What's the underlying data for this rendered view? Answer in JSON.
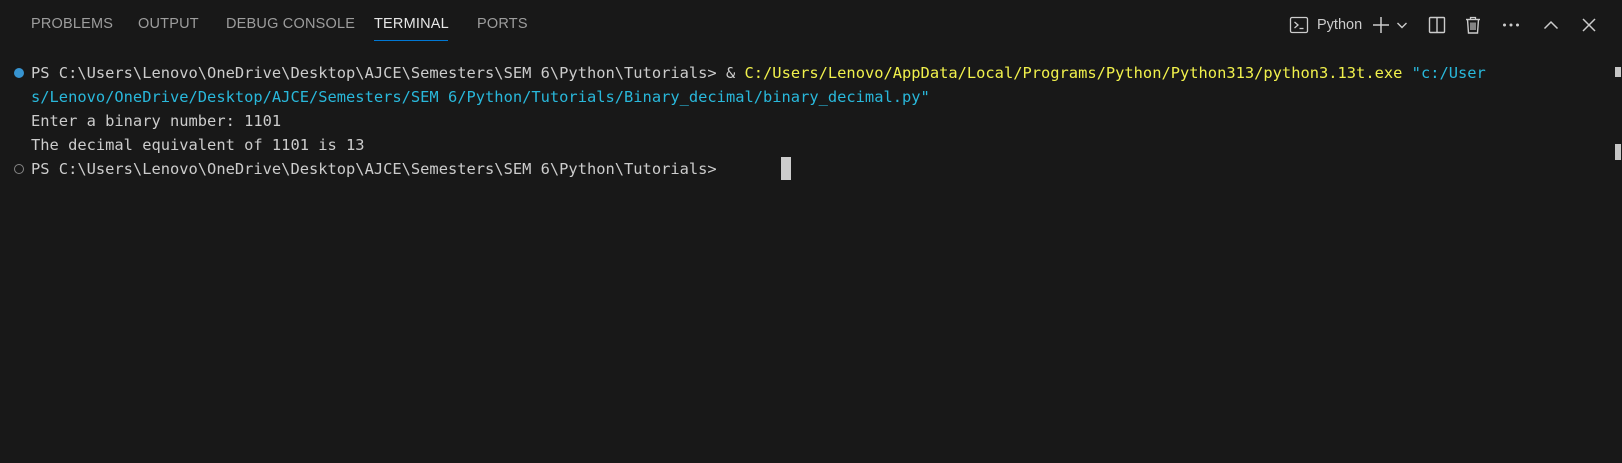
{
  "tabs": [
    {
      "label": "PROBLEMS"
    },
    {
      "label": "OUTPUT"
    },
    {
      "label": "DEBUG CONSOLE"
    },
    {
      "label": "TERMINAL",
      "active": true
    },
    {
      "label": "PORTS"
    }
  ],
  "toolbar": {
    "shell_label": "Python",
    "shell_icon": "terminal-icon",
    "new_terminal_icon": "plus-icon",
    "dropdown_icon": "chevron-down-icon",
    "split_icon": "split-terminal-icon",
    "kill_icon": "trash-icon",
    "more_icon": "ellipsis-icon",
    "maximize_icon": "chevron-up-icon",
    "close_icon": "close-icon"
  },
  "terminal": {
    "command": {
      "prompt": "PS C:\\Users\\Lenovo\\OneDrive\\Desktop\\AJCE\\Semesters\\SEM 6\\Python\\Tutorials> ",
      "operator": "& ",
      "exe": "C:/Users/Lenovo/AppData/Local/Programs/Python/Python313/python3.13t.exe",
      "arg_part1": "\"c:/User",
      "arg_part2": "s/Lenovo/OneDrive/Desktop/AJCE/Semesters/SEM 6/Python/Tutorials/Binary_decimal/binary_decimal.py\""
    },
    "output": [
      "Enter a binary number: 1101",
      "The decimal equivalent of 1101 is 13"
    ],
    "current_prompt": "PS C:\\Users\\Lenovo\\OneDrive\\Desktop\\AJCE\\Semesters\\SEM 6\\Python\\Tutorials> "
  },
  "colors": {
    "background": "#181818",
    "text": "#cccccc",
    "executable": "#f1f14c",
    "string_argument": "#29b8db",
    "tab_underline": "#0078d4",
    "success_decoration": "#3794d1"
  }
}
